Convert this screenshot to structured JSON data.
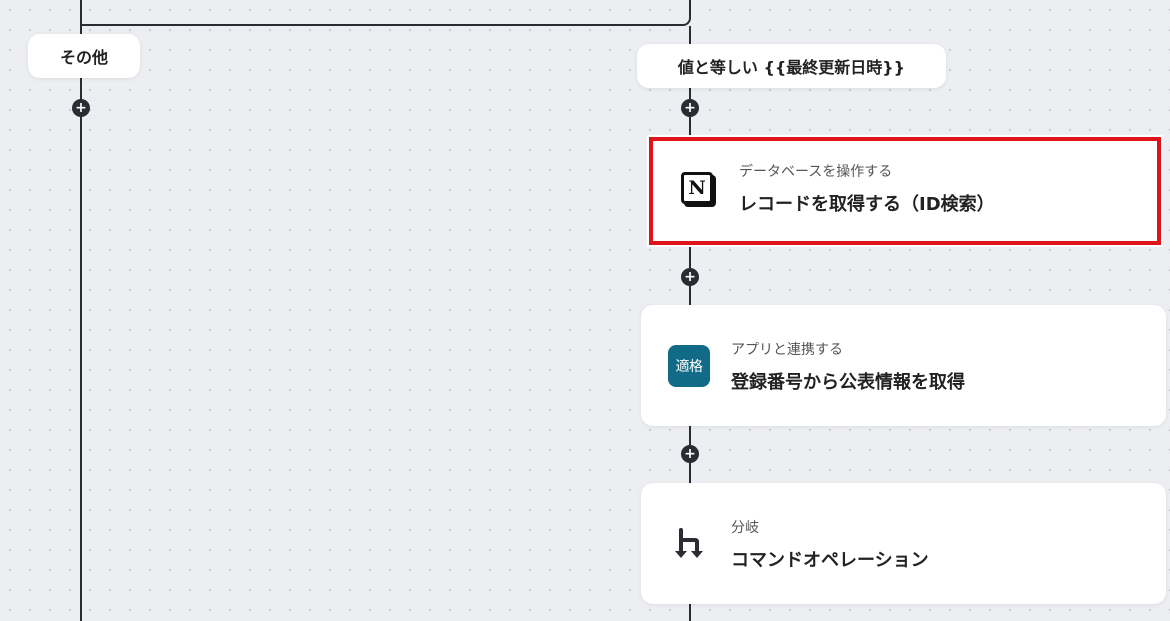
{
  "branches": {
    "left_label": "その他",
    "right_label": "値と等しい {{最終更新日時}}"
  },
  "plus_symbol": "+",
  "cards": [
    {
      "subtitle": "データベースを操作する",
      "title": "レコードを取得する（ID検索）",
      "icon": "notion-icon",
      "icon_text": "N",
      "selected": true
    },
    {
      "subtitle": "アプリと連携する",
      "title": "登録番号から公表情報を取得",
      "icon": "tekikaku-app-icon",
      "icon_text": "適格"
    },
    {
      "subtitle": "分岐",
      "title": "コマンドオペレーション",
      "icon": "branch-icon"
    }
  ],
  "colors": {
    "line": "#2a2c33",
    "selection_border": "#e0131a",
    "teal_icon": "#126b86",
    "canvas": "#eceef2"
  }
}
